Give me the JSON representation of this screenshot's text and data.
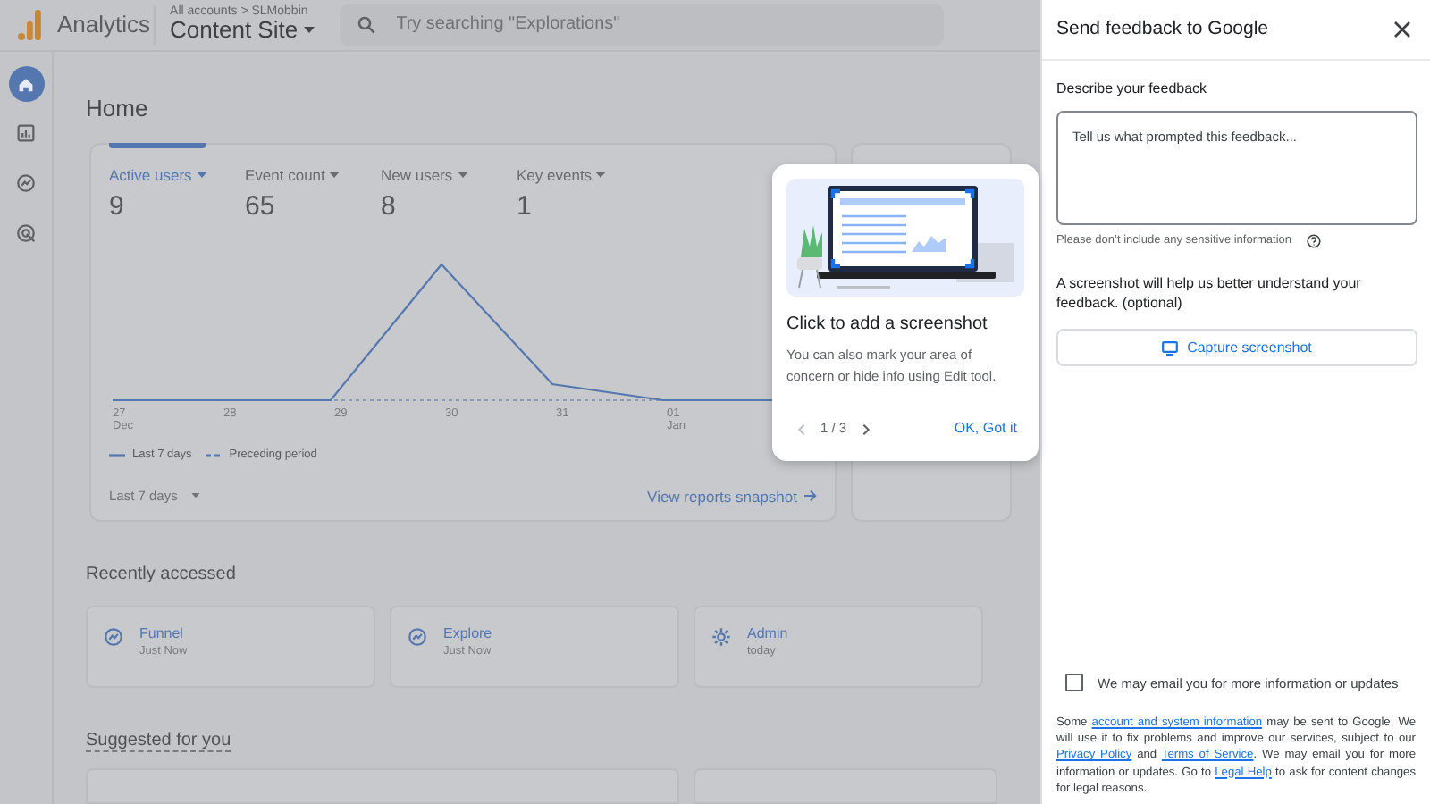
{
  "header": {
    "product": "Analytics",
    "breadcrumb": "All accounts > SLMobbin",
    "property": "Content Site",
    "search_placeholder": "Try searching \"Explorations\""
  },
  "sidebar": {
    "items": [
      {
        "kind": "home",
        "selected": true
      },
      {
        "kind": "reports",
        "selected": false
      },
      {
        "kind": "explore",
        "selected": false
      },
      {
        "kind": "advertising",
        "selected": false
      }
    ]
  },
  "page_title": "Home",
  "overview": {
    "metrics": [
      {
        "label": "Active users",
        "value": "9",
        "selected": true
      },
      {
        "label": "Event count",
        "value": "65",
        "selected": false
      },
      {
        "label": "New users",
        "value": "8",
        "selected": false
      },
      {
        "label": "Key events",
        "value": "1",
        "selected": false
      }
    ],
    "x_labels": [
      {
        "day": "27",
        "month": "Dec"
      },
      {
        "day": "28"
      },
      {
        "day": "29"
      },
      {
        "day": "30"
      },
      {
        "day": "31"
      },
      {
        "day": "01",
        "month": "Jan"
      }
    ],
    "legend": [
      "Last 7 days",
      "Preceding period"
    ],
    "range": "Last 7 days",
    "link": "View reports snapshot"
  },
  "recently_accessed": {
    "title": "Recently accessed",
    "items": [
      {
        "kind": "explore",
        "name": "Funnel",
        "time": "Just Now"
      },
      {
        "kind": "explore",
        "name": "Explore",
        "time": "Just Now"
      },
      {
        "kind": "admin",
        "name": "Admin",
        "time": "today"
      }
    ]
  },
  "suggested": {
    "title": "Suggested for you"
  },
  "tooltip": {
    "title": "Click to add a screenshot",
    "body": "You can also mark your area of concern or hide info using Edit tool.",
    "pager": "1 / 3",
    "action": "OK, Got it"
  },
  "feedback": {
    "title": "Send feedback to Google",
    "label": "Describe your feedback",
    "placeholder": "Tell us what prompted this feedback...",
    "note": "Please don’t include any sensitive information",
    "screenshot_text": "A screenshot will help us better understand your feedback. (optional)",
    "capture": "Capture screenshot",
    "email_opt_in": {
      "label": "We may email you for more information or updates",
      "checked": false
    },
    "legal": [
      {
        "kind": "text",
        "text": "Some "
      },
      {
        "kind": "link",
        "text": "account and system information"
      },
      {
        "kind": "text",
        "text": " may be sent to Google. We will use it to fix problems and improve our services, subject to our "
      },
      {
        "kind": "link",
        "text": "Privacy Policy"
      },
      {
        "kind": "text",
        "text": " and "
      },
      {
        "kind": "link",
        "text": "Terms of Service"
      },
      {
        "kind": "text",
        "text": ". We may email you for more information or updates. Go to "
      },
      {
        "kind": "link",
        "text": "Legal Help"
      },
      {
        "kind": "text",
        "text": " to ask for content changes for legal reasons."
      }
    ]
  }
}
